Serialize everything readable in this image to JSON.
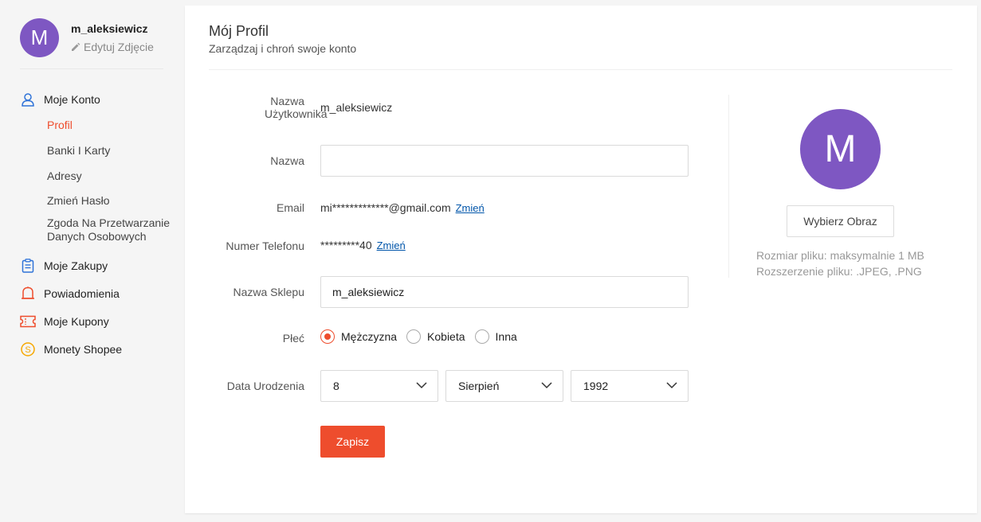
{
  "user": {
    "username": "m_aleksiewicz",
    "avatar_initial": "M",
    "edit_photo_label": "Edytuj Zdjęcie"
  },
  "sidebar": {
    "my_account": "Moje Konto",
    "sub_items": [
      {
        "label": "Profil",
        "active": true
      },
      {
        "label": "Banki I Karty"
      },
      {
        "label": "Adresy"
      },
      {
        "label": "Zmień Hasło"
      },
      {
        "label": "Zgoda Na Przetwarzanie Danych Osobowych"
      }
    ],
    "items": [
      {
        "label": "Moje Zakupy",
        "icon": "clipboard-icon"
      },
      {
        "label": "Powiadomienia",
        "icon": "bell-icon"
      },
      {
        "label": "Moje Kupony",
        "icon": "ticket-icon"
      },
      {
        "label": "Monety Shopee",
        "icon": "coin-icon"
      }
    ]
  },
  "header": {
    "title": "Mój Profil",
    "subtitle": "Zarządzaj i chroń swoje konto"
  },
  "form": {
    "username_label": "Nazwa Użytkownika",
    "username_value": "m_aleksiewicz",
    "name_label": "Nazwa",
    "name_value": "",
    "email_label": "Email",
    "email_value": "mi*************@gmail.com",
    "change_label": "Zmień",
    "phone_label": "Numer Telefonu",
    "phone_value": "*********40",
    "shop_label": "Nazwa Sklepu",
    "shop_value": "m_aleksiewicz",
    "gender_label": "Płeć",
    "gender_options": [
      "Mężczyzna",
      "Kobieta",
      "Inna"
    ],
    "gender_selected": "Mężczyzna",
    "birth_label": "Data Urodzenia",
    "birth_day": "8",
    "birth_month": "Sierpień",
    "birth_year": "1992",
    "save_label": "Zapisz"
  },
  "avatar_panel": {
    "initial": "M",
    "choose_label": "Wybierz Obraz",
    "size_note": "Rozmiar pliku: maksymalnie 1 MB",
    "ext_note": "Rozszerzenie pliku: .JPEG, .PNG"
  },
  "colors": {
    "accent": "#ee4d2d",
    "avatar": "#7e57c2",
    "link": "#0055aa"
  }
}
